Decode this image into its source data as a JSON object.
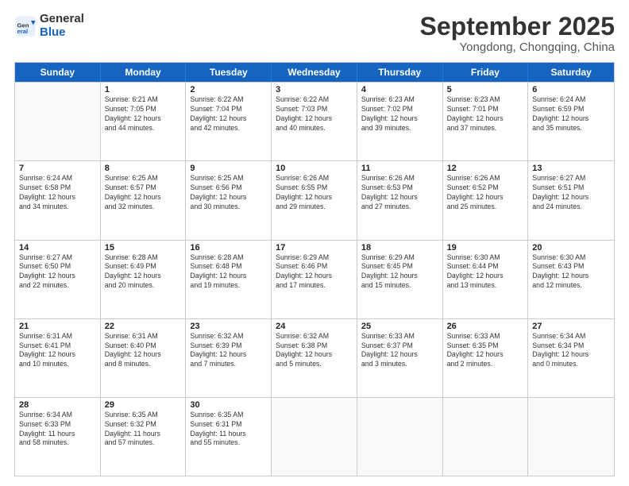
{
  "header": {
    "logo": {
      "general": "General",
      "blue": "Blue"
    },
    "title": "September 2025",
    "subtitle": "Yongdong, Chongqing, China"
  },
  "calendar": {
    "days": [
      "Sunday",
      "Monday",
      "Tuesday",
      "Wednesday",
      "Thursday",
      "Friday",
      "Saturday"
    ],
    "weeks": [
      [
        {
          "day": "",
          "empty": true
        },
        {
          "day": "1",
          "lines": [
            "Sunrise: 6:21 AM",
            "Sunset: 7:05 PM",
            "Daylight: 12 hours",
            "and 44 minutes."
          ]
        },
        {
          "day": "2",
          "lines": [
            "Sunrise: 6:22 AM",
            "Sunset: 7:04 PM",
            "Daylight: 12 hours",
            "and 42 minutes."
          ]
        },
        {
          "day": "3",
          "lines": [
            "Sunrise: 6:22 AM",
            "Sunset: 7:03 PM",
            "Daylight: 12 hours",
            "and 40 minutes."
          ]
        },
        {
          "day": "4",
          "lines": [
            "Sunrise: 6:23 AM",
            "Sunset: 7:02 PM",
            "Daylight: 12 hours",
            "and 39 minutes."
          ]
        },
        {
          "day": "5",
          "lines": [
            "Sunrise: 6:23 AM",
            "Sunset: 7:01 PM",
            "Daylight: 12 hours",
            "and 37 minutes."
          ]
        },
        {
          "day": "6",
          "lines": [
            "Sunrise: 6:24 AM",
            "Sunset: 6:59 PM",
            "Daylight: 12 hours",
            "and 35 minutes."
          ]
        }
      ],
      [
        {
          "day": "7",
          "lines": [
            "Sunrise: 6:24 AM",
            "Sunset: 6:58 PM",
            "Daylight: 12 hours",
            "and 34 minutes."
          ]
        },
        {
          "day": "8",
          "lines": [
            "Sunrise: 6:25 AM",
            "Sunset: 6:57 PM",
            "Daylight: 12 hours",
            "and 32 minutes."
          ]
        },
        {
          "day": "9",
          "lines": [
            "Sunrise: 6:25 AM",
            "Sunset: 6:56 PM",
            "Daylight: 12 hours",
            "and 30 minutes."
          ]
        },
        {
          "day": "10",
          "lines": [
            "Sunrise: 6:26 AM",
            "Sunset: 6:55 PM",
            "Daylight: 12 hours",
            "and 29 minutes."
          ]
        },
        {
          "day": "11",
          "lines": [
            "Sunrise: 6:26 AM",
            "Sunset: 6:53 PM",
            "Daylight: 12 hours",
            "and 27 minutes."
          ]
        },
        {
          "day": "12",
          "lines": [
            "Sunrise: 6:26 AM",
            "Sunset: 6:52 PM",
            "Daylight: 12 hours",
            "and 25 minutes."
          ]
        },
        {
          "day": "13",
          "lines": [
            "Sunrise: 6:27 AM",
            "Sunset: 6:51 PM",
            "Daylight: 12 hours",
            "and 24 minutes."
          ]
        }
      ],
      [
        {
          "day": "14",
          "lines": [
            "Sunrise: 6:27 AM",
            "Sunset: 6:50 PM",
            "Daylight: 12 hours",
            "and 22 minutes."
          ]
        },
        {
          "day": "15",
          "lines": [
            "Sunrise: 6:28 AM",
            "Sunset: 6:49 PM",
            "Daylight: 12 hours",
            "and 20 minutes."
          ]
        },
        {
          "day": "16",
          "lines": [
            "Sunrise: 6:28 AM",
            "Sunset: 6:48 PM",
            "Daylight: 12 hours",
            "and 19 minutes."
          ]
        },
        {
          "day": "17",
          "lines": [
            "Sunrise: 6:29 AM",
            "Sunset: 6:46 PM",
            "Daylight: 12 hours",
            "and 17 minutes."
          ]
        },
        {
          "day": "18",
          "lines": [
            "Sunrise: 6:29 AM",
            "Sunset: 6:45 PM",
            "Daylight: 12 hours",
            "and 15 minutes."
          ]
        },
        {
          "day": "19",
          "lines": [
            "Sunrise: 6:30 AM",
            "Sunset: 6:44 PM",
            "Daylight: 12 hours",
            "and 13 minutes."
          ]
        },
        {
          "day": "20",
          "lines": [
            "Sunrise: 6:30 AM",
            "Sunset: 6:43 PM",
            "Daylight: 12 hours",
            "and 12 minutes."
          ]
        }
      ],
      [
        {
          "day": "21",
          "lines": [
            "Sunrise: 6:31 AM",
            "Sunset: 6:41 PM",
            "Daylight: 12 hours",
            "and 10 minutes."
          ]
        },
        {
          "day": "22",
          "lines": [
            "Sunrise: 6:31 AM",
            "Sunset: 6:40 PM",
            "Daylight: 12 hours",
            "and 8 minutes."
          ]
        },
        {
          "day": "23",
          "lines": [
            "Sunrise: 6:32 AM",
            "Sunset: 6:39 PM",
            "Daylight: 12 hours",
            "and 7 minutes."
          ]
        },
        {
          "day": "24",
          "lines": [
            "Sunrise: 6:32 AM",
            "Sunset: 6:38 PM",
            "Daylight: 12 hours",
            "and 5 minutes."
          ]
        },
        {
          "day": "25",
          "lines": [
            "Sunrise: 6:33 AM",
            "Sunset: 6:37 PM",
            "Daylight: 12 hours",
            "and 3 minutes."
          ]
        },
        {
          "day": "26",
          "lines": [
            "Sunrise: 6:33 AM",
            "Sunset: 6:35 PM",
            "Daylight: 12 hours",
            "and 2 minutes."
          ]
        },
        {
          "day": "27",
          "lines": [
            "Sunrise: 6:34 AM",
            "Sunset: 6:34 PM",
            "Daylight: 12 hours",
            "and 0 minutes."
          ]
        }
      ],
      [
        {
          "day": "28",
          "lines": [
            "Sunrise: 6:34 AM",
            "Sunset: 6:33 PM",
            "Daylight: 11 hours",
            "and 58 minutes."
          ]
        },
        {
          "day": "29",
          "lines": [
            "Sunrise: 6:35 AM",
            "Sunset: 6:32 PM",
            "Daylight: 11 hours",
            "and 57 minutes."
          ]
        },
        {
          "day": "30",
          "lines": [
            "Sunrise: 6:35 AM",
            "Sunset: 6:31 PM",
            "Daylight: 11 hours",
            "and 55 minutes."
          ]
        },
        {
          "day": "",
          "empty": true
        },
        {
          "day": "",
          "empty": true
        },
        {
          "day": "",
          "empty": true
        },
        {
          "day": "",
          "empty": true
        }
      ]
    ]
  }
}
